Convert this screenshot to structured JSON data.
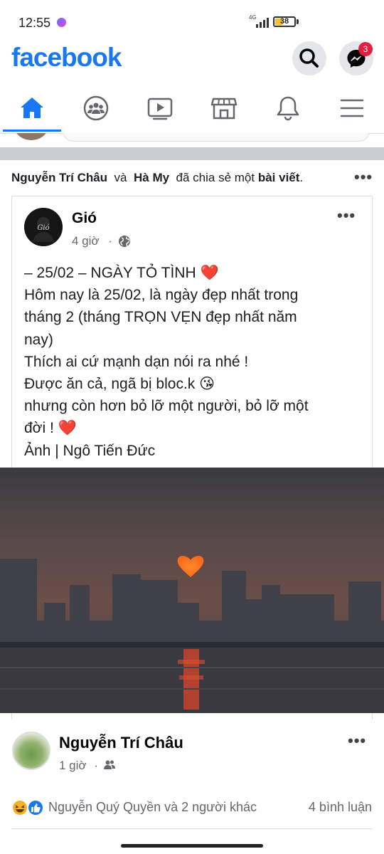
{
  "status_bar": {
    "time": "12:55",
    "network": "4G",
    "battery": "38"
  },
  "header": {
    "logo": "facebook",
    "messenger_badge": "3"
  },
  "nav": {
    "tabs": [
      {
        "name": "home-icon",
        "active": true
      },
      {
        "name": "groups-icon",
        "active": false
      },
      {
        "name": "video-icon",
        "active": false
      },
      {
        "name": "marketplace-icon",
        "active": false
      },
      {
        "name": "bell-icon",
        "active": false
      },
      {
        "name": "menu-icon",
        "active": false
      }
    ]
  },
  "share_header": {
    "user1": "Nguyễn Trí Châu",
    "conj": "và",
    "user2": "Hà My",
    "action": "đã chia sẻ một",
    "object": "bài viết",
    "period": ".",
    "more": "•••"
  },
  "post": {
    "author": "Gió",
    "time": "4 giờ",
    "separator": "·",
    "avatar_text": "Gió",
    "more": "•••",
    "text_lines": [
      "– 25/02 – NGÀY TỎ TÌNH ❤️",
      "Hôm nay là 25/02, là ngày đẹp nhất trong",
      "tháng 2 (tháng TRỌN VẸN đẹp nhất năm",
      "nay)",
      "Thích ai cứ mạnh dạn nói ra nhé !",
      "Được ăn cả, ngã bị bloc.k 😘",
      "nhưng còn hơn bỏ lỡ một người, bỏ lỡ một",
      "đời ! ❤️",
      "Ảnh | Ngô Tiến Đức"
    ]
  },
  "sharer": {
    "name": "Nguyễn Trí Châu",
    "time": "1 giờ",
    "separator": "·",
    "more": "•••"
  },
  "reactions": {
    "text": "Nguyễn Quý Quyền và 2 người khác",
    "comments": "4 bình luận"
  },
  "colors": {
    "brand": "#1877f2",
    "badge": "#e41e3f",
    "divider": "#c9ccd1"
  }
}
